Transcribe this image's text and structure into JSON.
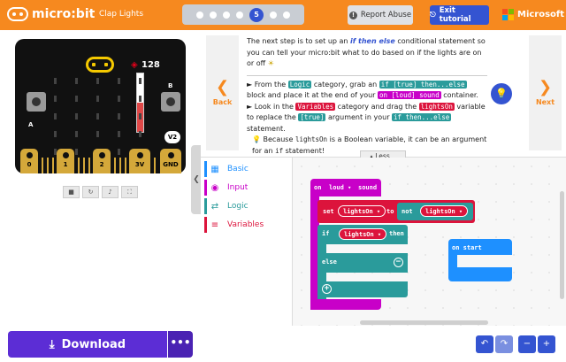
{
  "header": {
    "app_name": "micro:bit",
    "project_name": "Clap Lights",
    "steps": {
      "count": 5,
      "current": 5,
      "current_label": "5"
    },
    "report_abuse": "Report Abuse",
    "exit_tutorial": "Exit tutorial",
    "brand": "Microsoft",
    "brand_colors": [
      "#f25022",
      "#7fba00",
      "#00a4ef",
      "#ffb900"
    ]
  },
  "simulator": {
    "light_level": "128",
    "light_level_fraction": 0.5,
    "badge": "V2",
    "button_a": "A",
    "button_b": "B",
    "pins": [
      "0",
      "1",
      "2",
      "3V",
      "GND"
    ],
    "controls": [
      "stop-icon",
      "restart-icon",
      "mute-icon",
      "fullscreen-icon"
    ]
  },
  "download": {
    "label": "Download",
    "more": "•••"
  },
  "tutorial": {
    "back": "Back",
    "next": "Next",
    "less": "Less...",
    "intro_1": "The next step is to set up an ",
    "intro_em": "if then else",
    "intro_2": " conditional statement so you can tell your micro:bit what to do based on if the lights are on or off ",
    "b1_1": "► From the ",
    "b1_logic": "Logic",
    "b1_2": " category, grab an ",
    "b1_block": "if [true] then...else",
    "b1_3": " block and place it at the end of your ",
    "b1_event": "on [loud] sound",
    "b1_4": " container.",
    "b2_1": "► Look in the ",
    "b2_var": "Variables",
    "b2_2": " category and drag the ",
    "b2_block": "lightsOn",
    "b2_3": " variable to replace the ",
    "b2_arg": "[true]",
    "b2_4": " argument in your ",
    "b2_block2": "if then...else",
    "b2_5": " statement.",
    "tip_1": " Because ",
    "tip_code": "lightsOn",
    "tip_2": " is a Boolean variable, it can be an argument for an ",
    "tip_code2": "if",
    "tip_3": " statement!"
  },
  "toolbox": {
    "categories": [
      {
        "label": "Basic",
        "color": "#1e90ff"
      },
      {
        "label": "Input",
        "color": "#c800c8"
      },
      {
        "label": "Logic",
        "color": "#2a9b9b"
      },
      {
        "label": "Variables",
        "color": "#dc143c"
      }
    ]
  },
  "workspace": {
    "event_block": {
      "prefix": "on",
      "value": "loud ▾",
      "suffix": "sound",
      "color": "#c800c8"
    },
    "set_block": {
      "label": "set",
      "var": "lightsOn ▾",
      "to": "to",
      "not": "not",
      "arg": "lightsOn ▾",
      "color": "#dc143c"
    },
    "if_block": {
      "if": "if",
      "var": "lightsOn ▾",
      "then": "then",
      "else": "else",
      "color": "#2a9b9b"
    },
    "on_start": {
      "label": "on start",
      "color": "#1e90ff"
    }
  }
}
